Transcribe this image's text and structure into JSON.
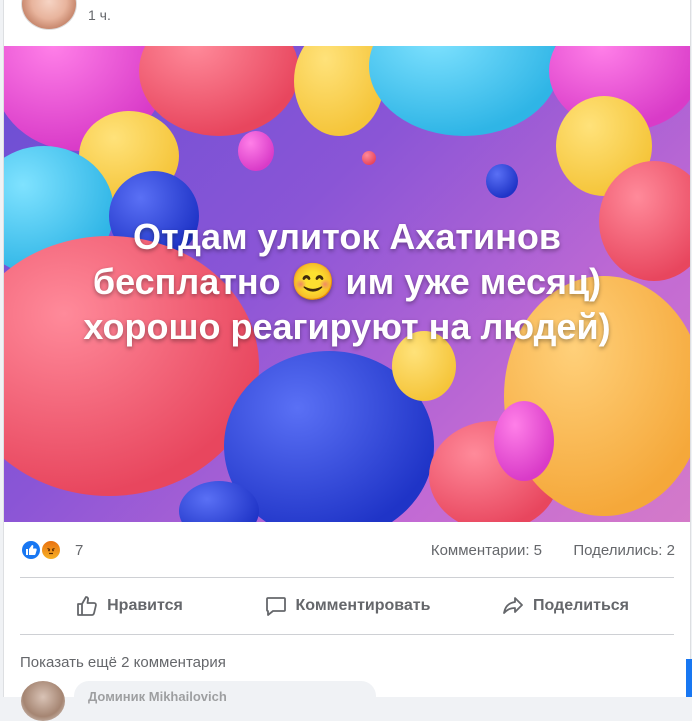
{
  "post": {
    "time": "1 ч.",
    "banner_lines": [
      "Отдам улиток Ахатинов",
      "бесплатно 😊 им уже месяц)",
      "хорошо реагируют на людей)"
    ],
    "banner_line1": "Отдам улиток Ахатинов",
    "banner_line2": "бесплатно 😊 им уже месяц)",
    "banner_line3": "хорошо реагируют на людей)"
  },
  "stats": {
    "reactions_count": "7",
    "comments": "Комментарии: 5",
    "shares": "Поделились: 2"
  },
  "actions": {
    "like": "Нравится",
    "comment": "Комментировать",
    "share": "Поделиться"
  },
  "comments": {
    "show_more": "Показать ещё 2 комментария",
    "first_author_partial": "Доминик Mikhailovich"
  },
  "colors": {
    "accent": "#1877f2",
    "muted_text": "#65676b",
    "banner_text": "#ffffff"
  },
  "icons": [
    "like-reaction-icon",
    "angry-reaction-icon",
    "thumbs-up-icon",
    "comment-icon",
    "share-icon"
  ]
}
